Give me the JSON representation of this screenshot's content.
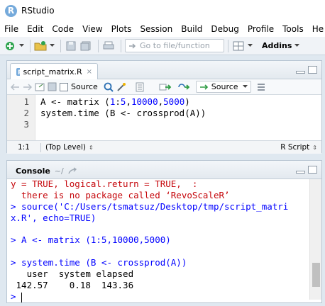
{
  "window": {
    "title": "RStudio"
  },
  "menu": [
    "File",
    "Edit",
    "Code",
    "View",
    "Plots",
    "Session",
    "Build",
    "Debug",
    "Profile",
    "Tools",
    "He"
  ],
  "toolbar": {
    "goto_placeholder": "Go to file/function",
    "addins_label": "Addins"
  },
  "editor": {
    "tab_name": "script_matrix.R",
    "source_on_save_label": "Source",
    "source_button_label": "Source",
    "lines": [
      {
        "num": "1",
        "text": "A <- matrix (1:5,10000,5000)"
      },
      {
        "num": "2",
        "text": "system.time (B <- crossprod(A))"
      },
      {
        "num": "3",
        "text": ""
      }
    ],
    "status_position": "1:1",
    "status_scope": "(Top Level)",
    "status_type": "R Script"
  },
  "console": {
    "tab_name": "Console",
    "path": "~/",
    "lines": [
      {
        "text": "y = TRUE, logical.return = TRUE,  :",
        "color": "#c5060b"
      },
      {
        "text": "  there is no package called ‘RevoScaleR’",
        "color": "#c5060b"
      },
      {
        "text": "> source('C:/Users/tsmatsuz/Desktop/tmp/script_matri",
        "color": "#0000ff"
      },
      {
        "text": "x.R', echo=TRUE)",
        "color": "#0000ff"
      },
      {
        "text": "",
        "color": "#000000"
      },
      {
        "text": "> A <- matrix (1:5,10000,5000)",
        "color": "#0000ff"
      },
      {
        "text": "",
        "color": "#000000"
      },
      {
        "text": "> system.time (B <- crossprod(A))",
        "color": "#0000ff"
      },
      {
        "text": "   user  system elapsed ",
        "color": "#000000"
      },
      {
        "text": " 142.57    0.18  143.36 ",
        "color": "#000000"
      },
      {
        "text": "> ",
        "color": "#0000ff"
      }
    ]
  }
}
